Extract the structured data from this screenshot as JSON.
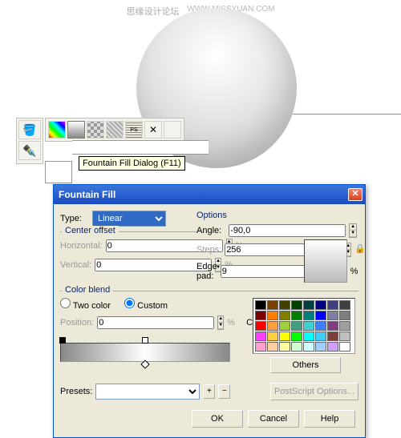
{
  "watermark": {
    "cn": "思缘设计论坛",
    "en": "WWW.MISSYUAN.COM"
  },
  "tooltip": "Fountain Fill Dialog (F11)",
  "dialog": {
    "title": "Fountain Fill",
    "type_label": "Type:",
    "type_value": "Linear",
    "options_label": "Options",
    "angle_label": "Angle:",
    "angle_value": "-90,0",
    "steps_label": "Steps:",
    "steps_value": "256",
    "edgepad_label": "Edge pad:",
    "edgepad_value": "9",
    "percent": "%",
    "center_offset_label": "Center offset",
    "horizontal_label": "Horizontal:",
    "horizontal_value": "0",
    "vertical_label": "Vertical:",
    "vertical_value": "0",
    "color_blend_label": "Color blend",
    "two_color_label": "Two color",
    "custom_label": "Custom",
    "position_label": "Position:",
    "position_value": "0",
    "current_label": "Current:",
    "others_label": "Others",
    "presets_label": "Presets:",
    "postscript_label": "PostScript Options...",
    "ok": "OK",
    "cancel": "Cancel",
    "help": "Help"
  },
  "palette_colors": [
    "#000000",
    "#7b3f00",
    "#404000",
    "#003f00",
    "#003f3f",
    "#00007f",
    "#3f3f7f",
    "#3f3f3f",
    "#7f0000",
    "#ff7f00",
    "#7f7f00",
    "#007f00",
    "#007f7f",
    "#0000ff",
    "#7f7f9f",
    "#7f7f7f",
    "#ff0000",
    "#ff9f3f",
    "#9fcf3f",
    "#3f9f7f",
    "#3fcfcf",
    "#3f7fff",
    "#7f3f7f",
    "#9f9f9f",
    "#ff3fff",
    "#ffcf3f",
    "#ffff00",
    "#00ff00",
    "#00ffff",
    "#3fcfff",
    "#7f3f3f",
    "#bfbfbf",
    "#ff9fcf",
    "#ffcf9f",
    "#ffff9f",
    "#cfffcf",
    "#cfffff",
    "#9fcfff",
    "#cf9fff",
    "#ffffff"
  ]
}
